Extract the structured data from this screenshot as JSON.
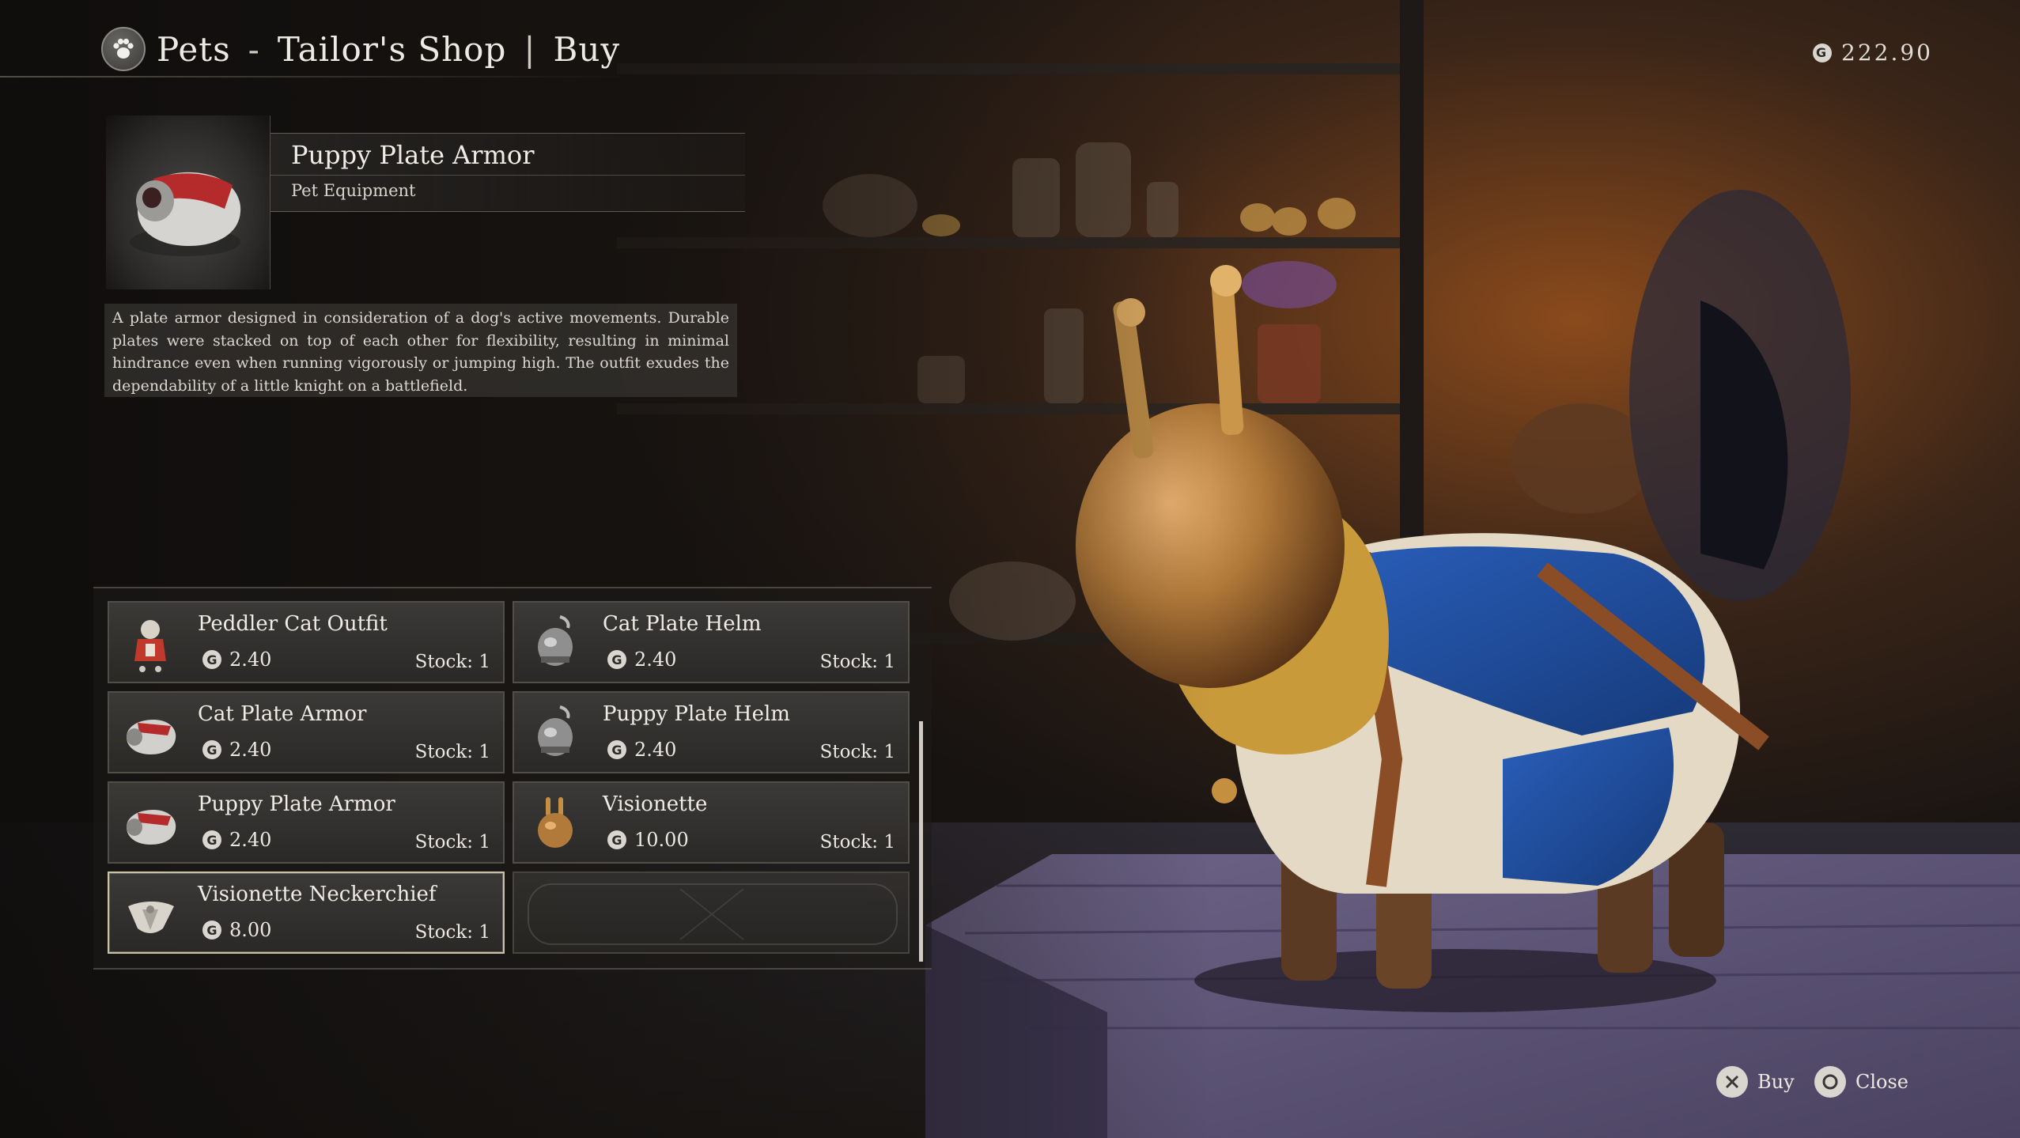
{
  "header": {
    "section": "Pets",
    "dash": "-",
    "shop": "Tailor's Shop",
    "divider": "|",
    "mode": "Buy"
  },
  "currency": {
    "amount": "222.90",
    "icon": "gil-coin-icon"
  },
  "detail": {
    "name": "Puppy Plate Armor",
    "type": "Pet Equipment",
    "description": "A plate armor designed in consideration of a dog's active movements. Durable plates were stacked on top of each other for flexibility, resulting in minimal hindrance even when running vigorously or jumping high. The outfit exudes the dependability of a little knight on a battlefield."
  },
  "items": [
    {
      "name": "Peddler Cat Outfit",
      "price": "2.40",
      "stock": "Stock: 1",
      "icon": "peddler-cat-outfit-icon"
    },
    {
      "name": "Cat Plate Helm",
      "price": "2.40",
      "stock": "Stock: 1",
      "icon": "helm-icon"
    },
    {
      "name": "Cat Plate Armor",
      "price": "2.40",
      "stock": "Stock: 1",
      "icon": "plate-armor-icon"
    },
    {
      "name": "Puppy Plate Helm",
      "price": "2.40",
      "stock": "Stock: 1",
      "icon": "helm-icon"
    },
    {
      "name": "Puppy Plate Armor",
      "price": "2.40",
      "stock": "Stock: 1",
      "icon": "plate-armor-icon"
    },
    {
      "name": "Visionette",
      "price": "10.00",
      "stock": "Stock: 1",
      "icon": "visionette-icon"
    },
    {
      "name": "Visionette Neckerchief",
      "price": "8.00",
      "stock": "Stock: 1",
      "icon": "neckerchief-icon",
      "selected": true
    }
  ],
  "prompts": {
    "buy": {
      "label": "Buy",
      "icon": "cross-button-icon"
    },
    "close": {
      "label": "Close",
      "icon": "circle-button-icon"
    }
  },
  "colors": {
    "accent_border": "#c9c2a8",
    "armor_blue": "#1f4fa0",
    "helm_bronze": "#b27a3a"
  }
}
